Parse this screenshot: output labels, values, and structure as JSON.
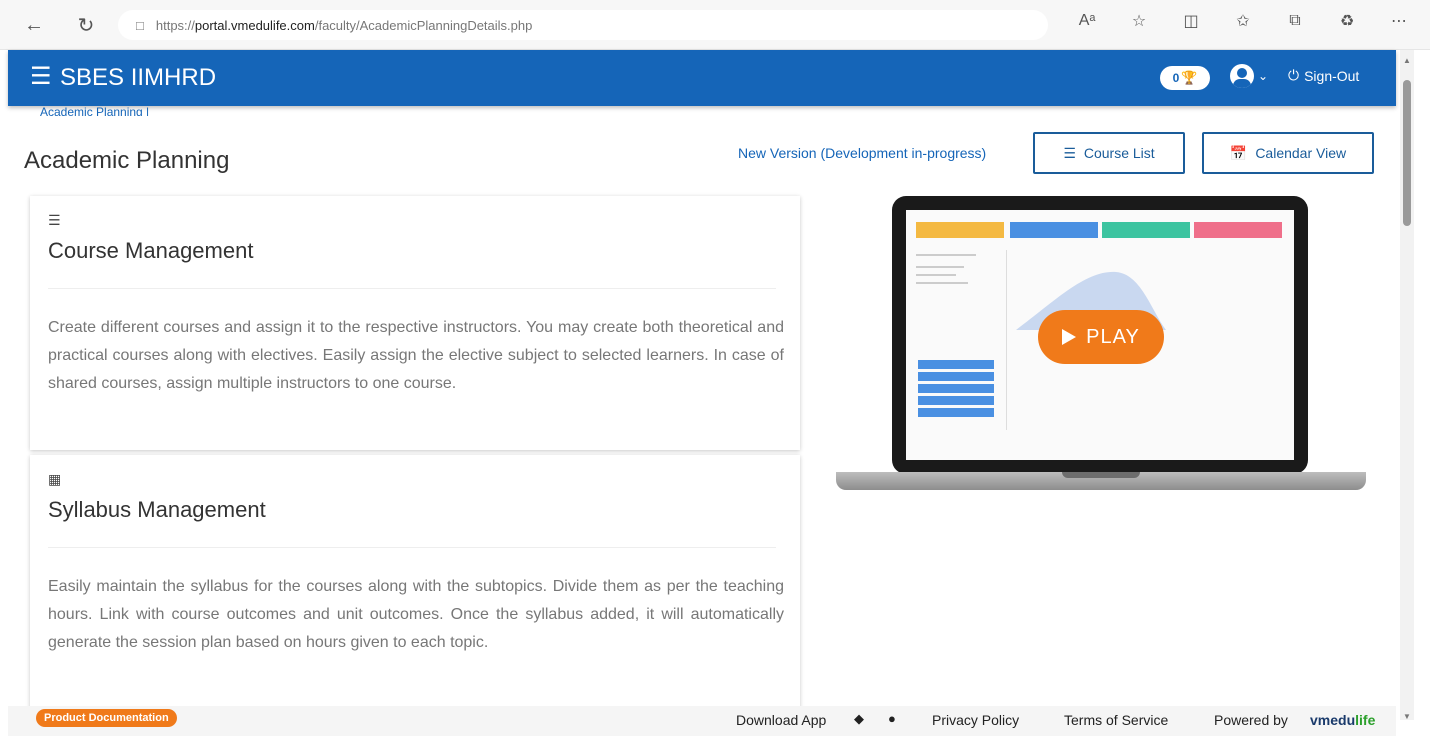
{
  "browser": {
    "url_scheme": "https://",
    "url_host": "portal.vmedulife.com",
    "url_path": "/faculty/AcademicPlanningDetails.php",
    "icons": [
      "read-aloud-icon",
      "favorite-star-icon",
      "split-screen-icon",
      "favorites-icon",
      "collections-icon",
      "extensions-icon",
      "more-icon"
    ]
  },
  "header": {
    "brand": "SBES IIMHRD",
    "badge_count": "0",
    "signout_label": "Sign-Out",
    "bg_color": "#1565b8"
  },
  "breadcrumb": "Academic Planning |",
  "page": {
    "title": "Academic Planning",
    "new_version_link": "New Version (Development in-progress)",
    "course_list_label": "Course List",
    "calendar_view_label": "Calendar View"
  },
  "cards": [
    {
      "title": "Course Management",
      "description": "Create different courses and assign it to the respective instructors. You may create both theoretical and practical courses along with electives. Easily assign the elective subject to selected learners. In case of shared courses, assign multiple instructors to one course."
    },
    {
      "title": "Syllabus Management",
      "description": "Easily maintain the syllabus for the courses along with the subtopics. Divide them as per the teaching hours. Link with course outcomes and unit outcomes. Once the syllabus added, it will automatically generate the session plan based on hours given to each topic."
    }
  ],
  "video": {
    "play_label": "PLAY",
    "accent_color": "#f07a1a"
  },
  "footer": {
    "product_documentation": "Product Documentation",
    "download_app": "Download App",
    "privacy_policy": "Privacy Policy",
    "terms_of_service": "Terms of Service",
    "powered_by": "Powered by",
    "brand_main": "vmedu",
    "brand_accent": "life"
  }
}
